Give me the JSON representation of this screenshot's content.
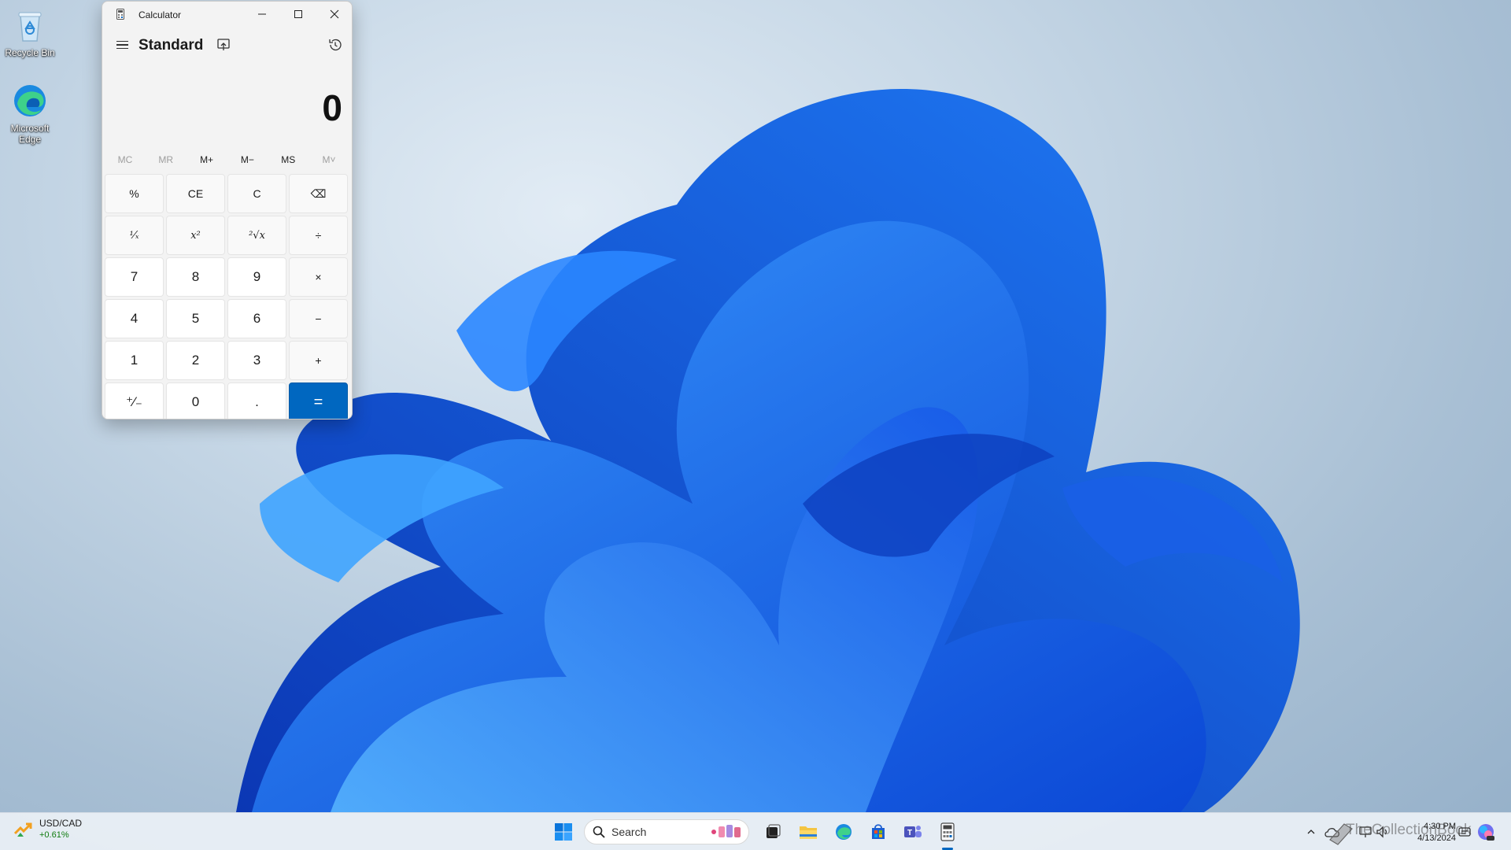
{
  "desktop": {
    "icons": [
      {
        "label": "Recycle Bin"
      },
      {
        "label": "Microsoft Edge"
      }
    ]
  },
  "calculator": {
    "window_title": "Calculator",
    "mode": "Standard",
    "display": "0",
    "memory_buttons": [
      "MC",
      "MR",
      "M+",
      "M−",
      "MS",
      "M˅"
    ],
    "keys": [
      "%",
      "CE",
      "C",
      "⌫",
      "¹⁄ₓ",
      "x²",
      "²√x",
      "÷",
      "7",
      "8",
      "9",
      "×",
      "4",
      "5",
      "6",
      "−",
      "1",
      "2",
      "3",
      "+",
      "⁺⁄₋",
      "0",
      ".",
      "="
    ],
    "accent_color": "#0067c0"
  },
  "taskbar": {
    "widget": {
      "ticker": "USD/CAD",
      "change": "+0.61%",
      "change_color": "#0f7b0f"
    },
    "search_placeholder": "Search",
    "pinned_icons": [
      "start-icon",
      "task-view-icon",
      "file-explorer-icon",
      "edge-icon",
      "store-icon",
      "teams-icon",
      "calculator-icon"
    ],
    "tray_icons": [
      "chevron-up-icon",
      "onedrive-icon",
      "network-icon",
      "volume-icon",
      "notification-icon",
      "copilot-icon"
    ],
    "clock": {
      "time": "4:30 PM",
      "date": "4/13/2024"
    },
    "watermark": "TheCollectionBook"
  }
}
